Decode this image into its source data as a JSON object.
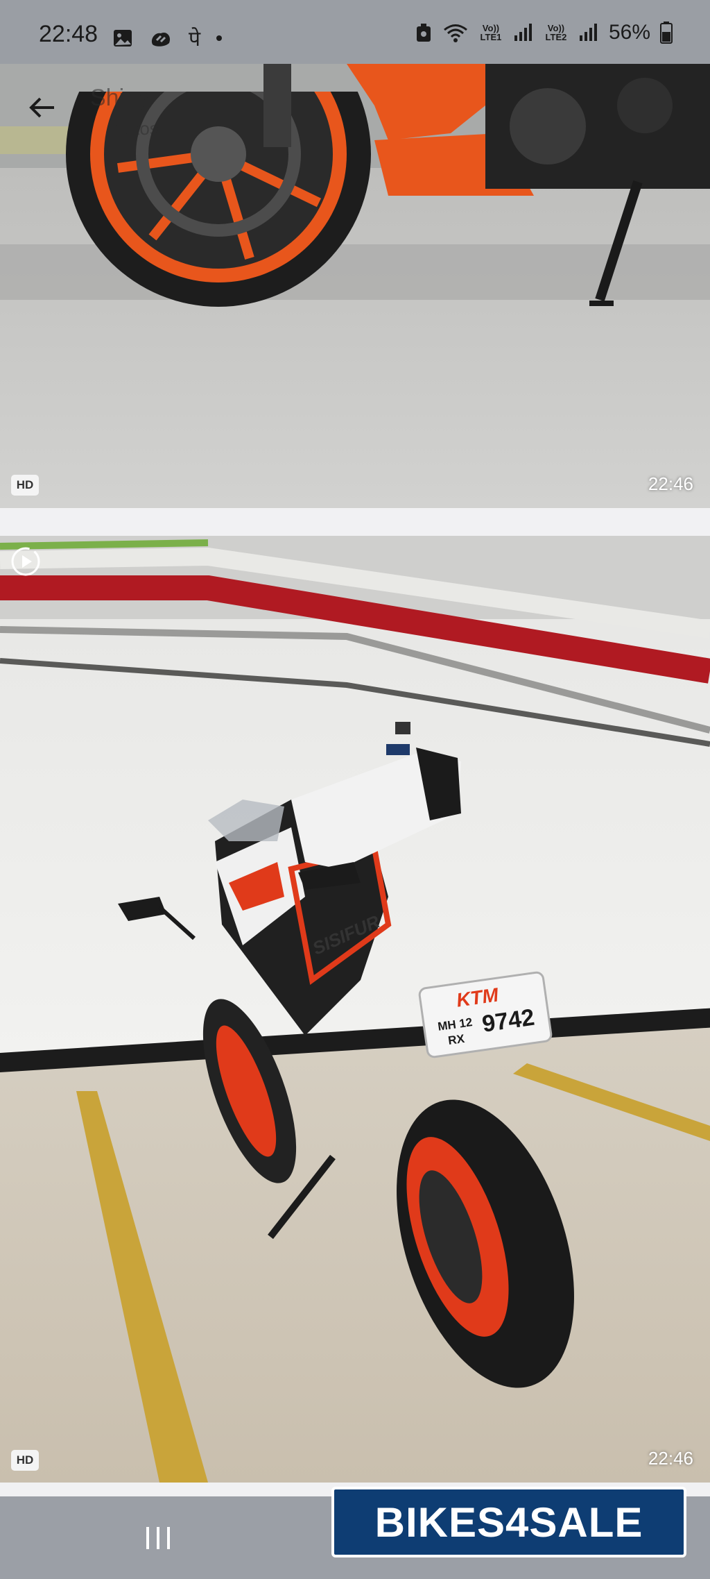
{
  "status_bar": {
    "time": "22:48",
    "notif_icons": [
      "gallery-icon",
      "teams-icon",
      "pe-icon",
      "dot-icon"
    ],
    "pe_glyph": "पे",
    "sim1": "Vo)) LTE1",
    "sim2": "Vo)) LTE2",
    "battery": "56%"
  },
  "header": {
    "title": "Shiny",
    "subtitle": "motos"
  },
  "photos": [
    {
      "hd_label": "HD",
      "time": "22:46"
    },
    {
      "hd_label": "HD",
      "time": "22:46"
    }
  ],
  "plate": {
    "brand": "KTM",
    "line1": "MH 12",
    "line2": "RX",
    "number": "9742"
  },
  "fairing_text": "SISIFUR",
  "watermark": "BIKES4SALE",
  "colors": {
    "ktm_orange": "#e8561c",
    "watermark_blue": "#0e3d73"
  }
}
